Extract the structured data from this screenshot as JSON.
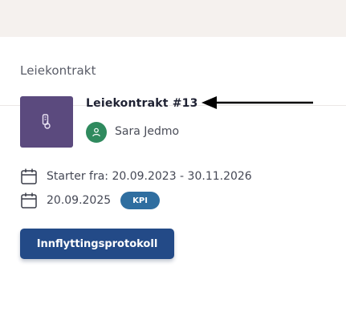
{
  "card": {
    "title": "Leiekontrakt"
  },
  "contract": {
    "name": "Leiekontrakt #13",
    "thumbnail_icon": "thermometer-icon",
    "tenant": {
      "name": "Sara Jedmo",
      "avatar_icon": "person-icon"
    },
    "period_label": "Starter fra: 20.09.2023 - 30.11.2026",
    "adjustment_date": "20.09.2025",
    "adjustment_badge": "KPI"
  },
  "actions": {
    "move_in_protocol_label": "Innflyttingsprotokoll"
  },
  "colors": {
    "top_band": "#f5f1ee",
    "thumbnail_bg": "#5b4a7e",
    "avatar_bg": "#2f8a5e",
    "badge_bg": "#2f6ea0",
    "button_bg": "#234a87"
  }
}
